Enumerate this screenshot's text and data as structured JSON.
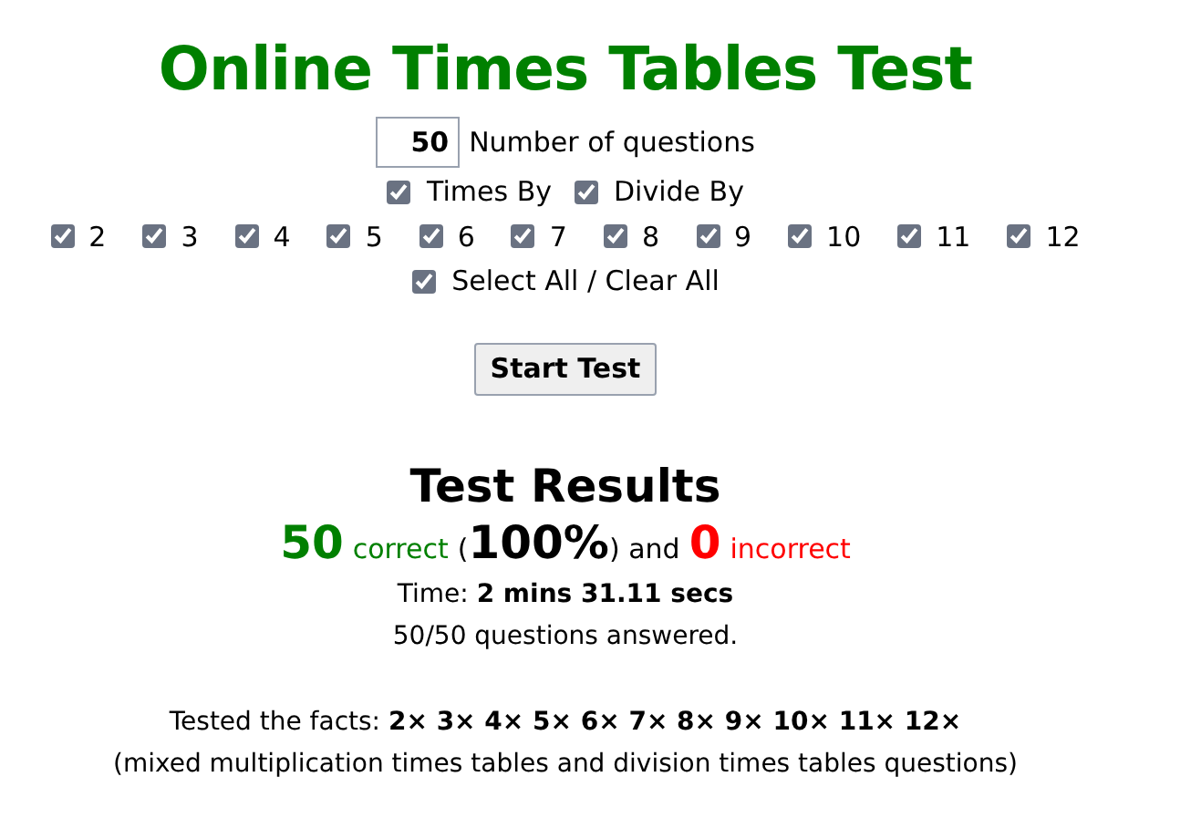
{
  "title": "Online Times Tables Test",
  "questions": {
    "value": "50",
    "label": "Number of questions"
  },
  "operations": [
    {
      "label": "Times By",
      "checked": true
    },
    {
      "label": "Divide By",
      "checked": true
    }
  ],
  "tables": [
    {
      "label": "2",
      "checked": true
    },
    {
      "label": "3",
      "checked": true
    },
    {
      "label": "4",
      "checked": true
    },
    {
      "label": "5",
      "checked": true
    },
    {
      "label": "6",
      "checked": true
    },
    {
      "label": "7",
      "checked": true
    },
    {
      "label": "8",
      "checked": true
    },
    {
      "label": "9",
      "checked": true
    },
    {
      "label": "10",
      "checked": true
    },
    {
      "label": "11",
      "checked": true
    },
    {
      "label": "12",
      "checked": true
    }
  ],
  "select_all": {
    "label": "Select All / Clear All",
    "checked": true
  },
  "start_button": "Start Test",
  "results": {
    "heading": "Test Results",
    "correct_count": "50",
    "correct_label": "correct",
    "open_paren": "(",
    "percent": "100%",
    "close_and": ") and",
    "incorrect_count": "0",
    "incorrect_label": "incorrect",
    "time": "Time: **2 mins 31.11 secs**",
    "answered": "50/50 questions answered.",
    "facts": "Tested the facts: **2× 3× 4× 5× 6× 7× 8× 9× 10× 11× 12×**",
    "note": "(mixed multiplication times tables and division times tables questions)"
  }
}
